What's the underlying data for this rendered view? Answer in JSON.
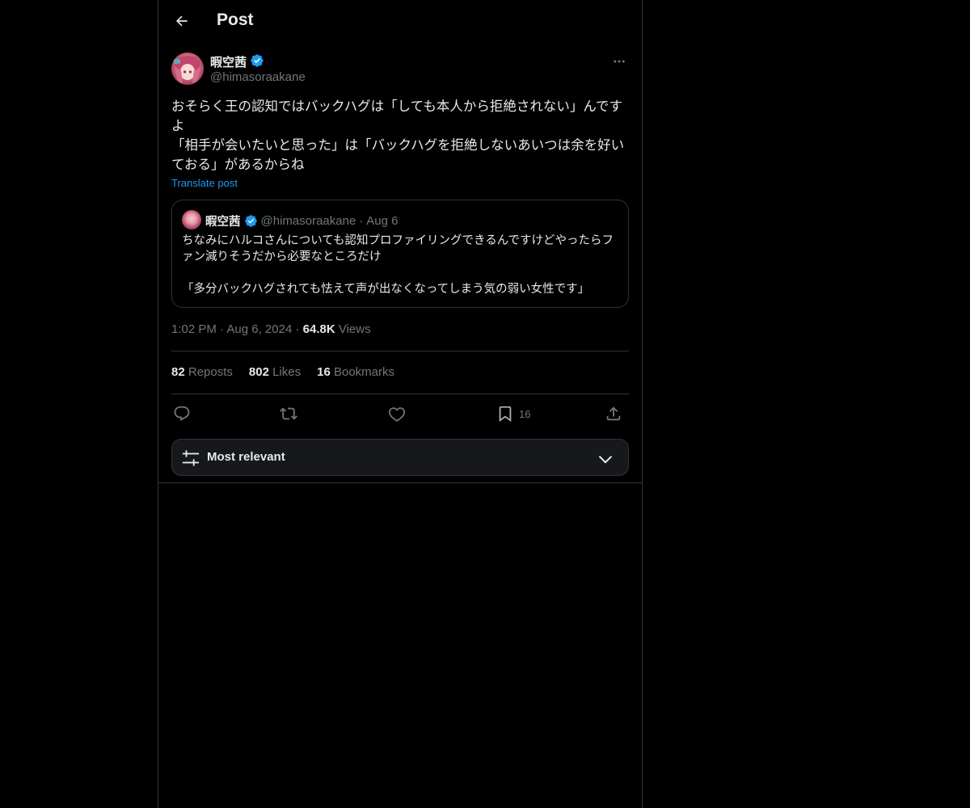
{
  "header": {
    "title": "Post",
    "back_icon": "arrow-left-icon"
  },
  "author": {
    "name": "暇空茜",
    "handle": "@himasoraakane",
    "verified_icon": "verified-badge-icon",
    "verified_color": "#1d9bf0"
  },
  "post": {
    "text": "おそらく王の認知ではバックハグは「しても本人から拒絶されない」んですよ\n「相手が会いたいと思った」は「バックハグを拒絶しないあいつは余を好いておる」があるからね",
    "translate_label": "Translate post"
  },
  "quote": {
    "name": "暇空茜",
    "handle": "@himasoraakane",
    "dot": "·",
    "date": "Aug 6",
    "text": "ちなみにハルコさんについても認知プロファイリングできるんですけどやったらファン減りそうだから必要なところだけ\n\n「多分バックハグされても怯えて声が出なくなってしまう気の弱い女性です」"
  },
  "meta": {
    "time": "1:02 PM",
    "dot1": "·",
    "date": "Aug 6, 2024",
    "dot2": "·",
    "views_count": "64.8K",
    "views_label": "Views"
  },
  "stats": {
    "reposts_count": "82",
    "reposts_label": "Reposts",
    "likes_count": "802",
    "likes_label": "Likes",
    "bookmarks_count": "16",
    "bookmarks_label": "Bookmarks"
  },
  "actions": {
    "bookmark_count": "16"
  },
  "sort": {
    "label": "Most relevant"
  },
  "colors": {
    "background": "#000000",
    "text": "#e7e9ea",
    "muted": "#71767b",
    "accent": "#1d9bf0",
    "border": "#2f3336"
  }
}
